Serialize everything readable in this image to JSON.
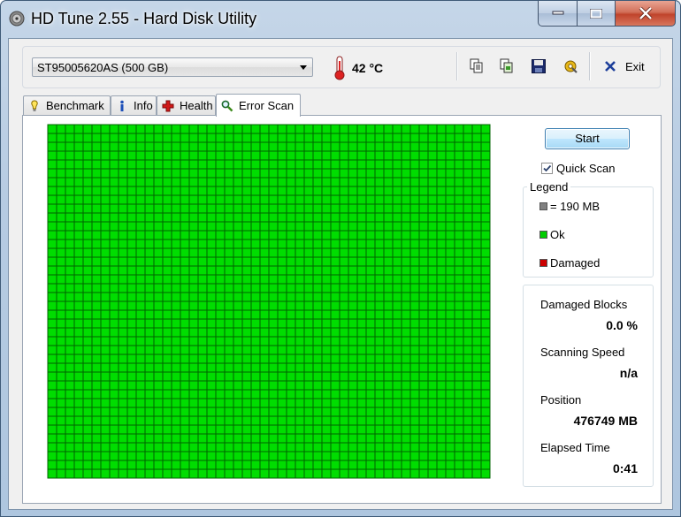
{
  "window": {
    "title": "HD Tune 2.55 - Hard Disk Utility"
  },
  "toolbar": {
    "drive": "ST95005620AS (500 GB)",
    "temperature": "42 °C",
    "exit_label": "Exit",
    "icons": [
      "copy-text-icon",
      "copy-screenshot-icon",
      "save-icon",
      "options-icon"
    ]
  },
  "tabs": [
    {
      "label": "Benchmark",
      "icon": "benchmark-icon"
    },
    {
      "label": "Info",
      "icon": "info-icon"
    },
    {
      "label": "Health",
      "icon": "health-icon"
    },
    {
      "label": "Error Scan",
      "icon": "magnifier-icon",
      "active": true
    }
  ],
  "scan": {
    "start_label": "Start",
    "quick_scan_label": "Quick Scan",
    "quick_scan_checked": true,
    "grid_columns": 50,
    "grid_rows": 40,
    "block_status": "ok"
  },
  "legend": {
    "title": "Legend",
    "items": [
      {
        "label": "= 190 MB",
        "color": "#808080"
      },
      {
        "label": "Ok",
        "color": "#00cc00"
      },
      {
        "label": "Damaged",
        "color": "#cc0000"
      }
    ]
  },
  "stats": {
    "damaged_blocks_label": "Damaged Blocks",
    "damaged_blocks_value": "0.0 %",
    "scanning_speed_label": "Scanning Speed",
    "scanning_speed_value": "n/a",
    "position_label": "Position",
    "position_value": "476749 MB",
    "elapsed_label": "Elapsed Time",
    "elapsed_value": "0:41"
  },
  "colors": {
    "ok": "#00dd00",
    "grid_line": "#006400"
  }
}
